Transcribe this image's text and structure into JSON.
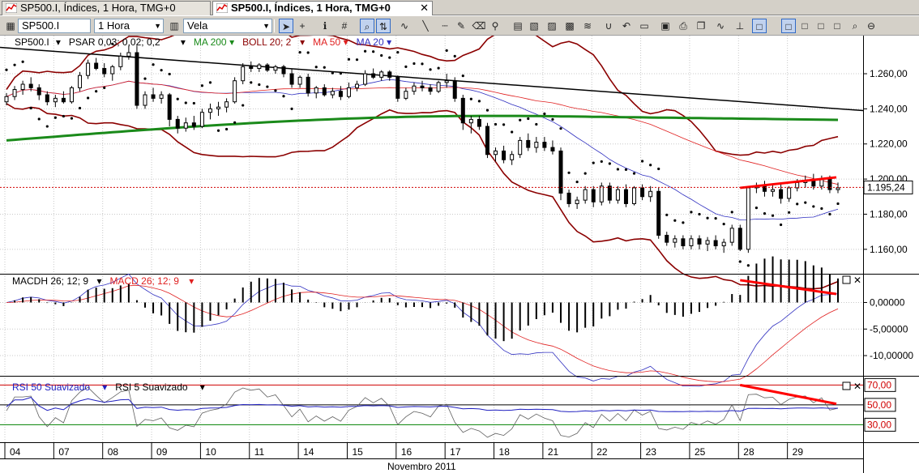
{
  "tabs": [
    {
      "label": "SP500.I, Índices, 1 Hora, TMG+0",
      "active": false
    },
    {
      "label": "SP500.I, Índices, 1 Hora, TMG+0",
      "active": true
    }
  ],
  "toolbar": {
    "symbol": "SP500.I",
    "timeframe": "1 Hora",
    "chart_style": "Vela",
    "icons": [
      "cursor-icon",
      "crosshair-icon",
      "info-icon",
      "grid-icon",
      "zoom-icon",
      "scale-icon",
      "wave-icon",
      "line-tool-icon",
      "dash-icon",
      "pencil-icon",
      "eraser-icon",
      "magnet-icon",
      "chart-a-icon",
      "chart-b-icon",
      "chart-c-icon",
      "chart-d-icon",
      "chart-e-icon",
      "magnet2-icon",
      "undo-icon",
      "open-icon",
      "save-icon",
      "print-icon",
      "copy-icon",
      "indicator-icon",
      "pin-icon",
      "layout-a-icon",
      "layout-b-icon",
      "layout-c-icon",
      "layout-d-icon",
      "layout-e-icon",
      "zoom-fit-icon",
      "zoom-out-icon"
    ]
  },
  "colors": {
    "candle": "#000000",
    "psar": "#000000",
    "ma200": "#1a8a1a",
    "boll": "#8b0000",
    "ma50": "#e02020",
    "ma20": "#3030c0",
    "trend": "#000000",
    "divergence": "#ff0000",
    "price_line": "#d00000",
    "rsi50": "#2020c0",
    "rsi5": "#606060",
    "rsi_overbought": "#d00000",
    "rsi_oversold": "#008000"
  },
  "price_panel": {
    "legend": [
      {
        "name": "SP500.I",
        "color": "#000000"
      },
      {
        "name": "PSAR 0,03; 0,02; 0,2",
        "color": "#000000"
      },
      {
        "name": "MA 200",
        "color": "#1a8a1a"
      },
      {
        "name": "BOLL 20; 2",
        "color": "#8b0000"
      },
      {
        "name": "MA 50",
        "color": "#e02020"
      },
      {
        "name": "MA 20",
        "color": "#3030c0"
      }
    ],
    "last_price": "1.195,24",
    "y_ticks": [
      "1.260,00",
      "1.240,00",
      "1.220,00",
      "1.200,00",
      "1.180,00",
      "1.160,00"
    ]
  },
  "macd_panel": {
    "legend": [
      {
        "name": "MACDH 26; 12; 9",
        "color": "#000000"
      },
      {
        "name": "MACD 26; 12; 9",
        "color": "#e02020"
      }
    ],
    "y_ticks": [
      "0,00000",
      "-5,00000",
      "-10,00000"
    ]
  },
  "rsi_panel": {
    "legend": [
      {
        "name": "RSI 50 Suavizado",
        "color": "#2020c0"
      },
      {
        "name": "RSI 5 Suavizado",
        "color": "#000000"
      }
    ],
    "y_ticks": [
      "70,00",
      "50,00",
      "30,00"
    ]
  },
  "x_axis": {
    "day_labels": [
      "04",
      "07",
      "08",
      "09",
      "10",
      "11",
      "14",
      "15",
      "16",
      "17",
      "18",
      "21",
      "22",
      "23",
      "25",
      "28",
      "29"
    ],
    "month_label": "Novembro 2011"
  },
  "chart_data": {
    "type": "candlestick",
    "symbol": "SP500.I",
    "timeframe": "1 Hora",
    "x_days": [
      "04",
      "07",
      "08",
      "09",
      "10",
      "11",
      "14",
      "15",
      "16",
      "17",
      "18",
      "21",
      "22",
      "23",
      "25",
      "28",
      "29"
    ],
    "price_ylim": [
      1147,
      1278
    ],
    "last_price": 1195.24,
    "candles": [
      {
        "o": 1244,
        "h": 1249,
        "l": 1242,
        "c": 1247
      },
      {
        "o": 1247,
        "h": 1253,
        "l": 1245,
        "c": 1251
      },
      {
        "o": 1251,
        "h": 1256,
        "l": 1248,
        "c": 1254
      },
      {
        "o": 1254,
        "h": 1258,
        "l": 1250,
        "c": 1252
      },
      {
        "o": 1252,
        "h": 1254,
        "l": 1245,
        "c": 1248
      },
      {
        "o": 1248,
        "h": 1250,
        "l": 1242,
        "c": 1244
      },
      {
        "o": 1244,
        "h": 1248,
        "l": 1241,
        "c": 1246
      },
      {
        "o": 1246,
        "h": 1250,
        "l": 1243,
        "c": 1244
      },
      {
        "o": 1244,
        "h": 1253,
        "l": 1243,
        "c": 1252
      },
      {
        "o": 1252,
        "h": 1261,
        "l": 1250,
        "c": 1259
      },
      {
        "o": 1259,
        "h": 1268,
        "l": 1257,
        "c": 1266
      },
      {
        "o": 1266,
        "h": 1269,
        "l": 1262,
        "c": 1263
      },
      {
        "o": 1263,
        "h": 1266,
        "l": 1258,
        "c": 1260
      },
      {
        "o": 1260,
        "h": 1265,
        "l": 1256,
        "c": 1264
      },
      {
        "o": 1264,
        "h": 1272,
        "l": 1262,
        "c": 1270
      },
      {
        "o": 1270,
        "h": 1276,
        "l": 1268,
        "c": 1272
      },
      {
        "o": 1272,
        "h": 1276,
        "l": 1240,
        "c": 1242
      },
      {
        "o": 1242,
        "h": 1250,
        "l": 1240,
        "c": 1248
      },
      {
        "o": 1248,
        "h": 1252,
        "l": 1244,
        "c": 1246
      },
      {
        "o": 1246,
        "h": 1250,
        "l": 1243,
        "c": 1248
      },
      {
        "o": 1248,
        "h": 1249,
        "l": 1230,
        "c": 1234
      },
      {
        "o": 1234,
        "h": 1236,
        "l": 1226,
        "c": 1229
      },
      {
        "o": 1229,
        "h": 1235,
        "l": 1227,
        "c": 1232
      },
      {
        "o": 1232,
        "h": 1236,
        "l": 1228,
        "c": 1230
      },
      {
        "o": 1230,
        "h": 1240,
        "l": 1229,
        "c": 1238
      },
      {
        "o": 1238,
        "h": 1243,
        "l": 1234,
        "c": 1240
      },
      {
        "o": 1240,
        "h": 1244,
        "l": 1236,
        "c": 1241
      },
      {
        "o": 1241,
        "h": 1246,
        "l": 1238,
        "c": 1244
      },
      {
        "o": 1244,
        "h": 1258,
        "l": 1243,
        "c": 1256
      },
      {
        "o": 1256,
        "h": 1266,
        "l": 1254,
        "c": 1264
      },
      {
        "o": 1264,
        "h": 1267,
        "l": 1261,
        "c": 1263
      },
      {
        "o": 1263,
        "h": 1266,
        "l": 1261,
        "c": 1265
      },
      {
        "o": 1265,
        "h": 1266,
        "l": 1261,
        "c": 1262
      },
      {
        "o": 1262,
        "h": 1265,
        "l": 1260,
        "c": 1264
      },
      {
        "o": 1264,
        "h": 1265,
        "l": 1258,
        "c": 1260
      },
      {
        "o": 1260,
        "h": 1263,
        "l": 1252,
        "c": 1254
      },
      {
        "o": 1254,
        "h": 1259,
        "l": 1252,
        "c": 1258
      },
      {
        "o": 1258,
        "h": 1260,
        "l": 1247,
        "c": 1249
      },
      {
        "o": 1249,
        "h": 1253,
        "l": 1246,
        "c": 1252
      },
      {
        "o": 1252,
        "h": 1254,
        "l": 1247,
        "c": 1248
      },
      {
        "o": 1248,
        "h": 1252,
        "l": 1246,
        "c": 1250
      },
      {
        "o": 1250,
        "h": 1253,
        "l": 1245,
        "c": 1247
      },
      {
        "o": 1247,
        "h": 1255,
        "l": 1246,
        "c": 1252
      },
      {
        "o": 1252,
        "h": 1256,
        "l": 1250,
        "c": 1254
      },
      {
        "o": 1254,
        "h": 1262,
        "l": 1253,
        "c": 1260
      },
      {
        "o": 1260,
        "h": 1263,
        "l": 1257,
        "c": 1258
      },
      {
        "o": 1258,
        "h": 1262,
        "l": 1256,
        "c": 1261
      },
      {
        "o": 1261,
        "h": 1262,
        "l": 1256,
        "c": 1258
      },
      {
        "o": 1258,
        "h": 1259,
        "l": 1244,
        "c": 1246
      },
      {
        "o": 1246,
        "h": 1252,
        "l": 1245,
        "c": 1250
      },
      {
        "o": 1250,
        "h": 1255,
        "l": 1248,
        "c": 1253
      },
      {
        "o": 1253,
        "h": 1256,
        "l": 1250,
        "c": 1252
      },
      {
        "o": 1252,
        "h": 1254,
        "l": 1248,
        "c": 1250
      },
      {
        "o": 1250,
        "h": 1256,
        "l": 1249,
        "c": 1255
      },
      {
        "o": 1255,
        "h": 1260,
        "l": 1252,
        "c": 1256
      },
      {
        "o": 1256,
        "h": 1258,
        "l": 1244,
        "c": 1246
      },
      {
        "o": 1246,
        "h": 1248,
        "l": 1228,
        "c": 1232
      },
      {
        "o": 1232,
        "h": 1236,
        "l": 1226,
        "c": 1234
      },
      {
        "o": 1234,
        "h": 1236,
        "l": 1228,
        "c": 1230
      },
      {
        "o": 1230,
        "h": 1232,
        "l": 1212,
        "c": 1214
      },
      {
        "o": 1214,
        "h": 1218,
        "l": 1210,
        "c": 1216
      },
      {
        "o": 1216,
        "h": 1219,
        "l": 1209,
        "c": 1211
      },
      {
        "o": 1211,
        "h": 1216,
        "l": 1208,
        "c": 1214
      },
      {
        "o": 1214,
        "h": 1224,
        "l": 1212,
        "c": 1222
      },
      {
        "o": 1222,
        "h": 1226,
        "l": 1216,
        "c": 1218
      },
      {
        "o": 1218,
        "h": 1224,
        "l": 1215,
        "c": 1221
      },
      {
        "o": 1221,
        "h": 1224,
        "l": 1216,
        "c": 1218
      },
      {
        "o": 1218,
        "h": 1222,
        "l": 1214,
        "c": 1216
      },
      {
        "o": 1216,
        "h": 1218,
        "l": 1188,
        "c": 1192
      },
      {
        "o": 1192,
        "h": 1194,
        "l": 1184,
        "c": 1186
      },
      {
        "o": 1186,
        "h": 1190,
        "l": 1183,
        "c": 1188
      },
      {
        "o": 1188,
        "h": 1196,
        "l": 1186,
        "c": 1194
      },
      {
        "o": 1194,
        "h": 1196,
        "l": 1184,
        "c": 1187
      },
      {
        "o": 1187,
        "h": 1198,
        "l": 1185,
        "c": 1196
      },
      {
        "o": 1196,
        "h": 1198,
        "l": 1186,
        "c": 1188
      },
      {
        "o": 1188,
        "h": 1196,
        "l": 1186,
        "c": 1194
      },
      {
        "o": 1194,
        "h": 1197,
        "l": 1184,
        "c": 1186
      },
      {
        "o": 1186,
        "h": 1196,
        "l": 1185,
        "c": 1195
      },
      {
        "o": 1195,
        "h": 1197,
        "l": 1188,
        "c": 1190
      },
      {
        "o": 1190,
        "h": 1196,
        "l": 1187,
        "c": 1193
      },
      {
        "o": 1193,
        "h": 1195,
        "l": 1166,
        "c": 1168
      },
      {
        "o": 1168,
        "h": 1170,
        "l": 1162,
        "c": 1164
      },
      {
        "o": 1164,
        "h": 1168,
        "l": 1161,
        "c": 1166
      },
      {
        "o": 1166,
        "h": 1168,
        "l": 1160,
        "c": 1162
      },
      {
        "o": 1162,
        "h": 1168,
        "l": 1160,
        "c": 1166
      },
      {
        "o": 1166,
        "h": 1168,
        "l": 1160,
        "c": 1163
      },
      {
        "o": 1163,
        "h": 1167,
        "l": 1159,
        "c": 1165
      },
      {
        "o": 1165,
        "h": 1168,
        "l": 1160,
        "c": 1162
      },
      {
        "o": 1162,
        "h": 1166,
        "l": 1158,
        "c": 1164
      },
      {
        "o": 1164,
        "h": 1174,
        "l": 1162,
        "c": 1172
      },
      {
        "o": 1172,
        "h": 1174,
        "l": 1159,
        "c": 1160
      },
      {
        "o": 1160,
        "h": 1196,
        "l": 1158,
        "c": 1195
      },
      {
        "o": 1195,
        "h": 1198,
        "l": 1192,
        "c": 1196
      },
      {
        "o": 1196,
        "h": 1199,
        "l": 1190,
        "c": 1193
      },
      {
        "o": 1193,
        "h": 1197,
        "l": 1190,
        "c": 1194
      },
      {
        "o": 1194,
        "h": 1198,
        "l": 1186,
        "c": 1189
      },
      {
        "o": 1189,
        "h": 1196,
        "l": 1187,
        "c": 1195
      },
      {
        "o": 1195,
        "h": 1200,
        "l": 1193,
        "c": 1198
      },
      {
        "o": 1198,
        "h": 1202,
        "l": 1195,
        "c": 1199
      },
      {
        "o": 1199,
        "h": 1203,
        "l": 1194,
        "c": 1196
      },
      {
        "o": 1196,
        "h": 1202,
        "l": 1194,
        "c": 1200
      },
      {
        "o": 1200,
        "h": 1202,
        "l": 1192,
        "c": 1194
      },
      {
        "o": 1194,
        "h": 1198,
        "l": 1192,
        "c": 1195
      }
    ],
    "macd_ylim": [
      -13.5,
      4.8
    ],
    "rsi_ylim": [
      14,
      76
    ],
    "rsi_levels": [
      70,
      50,
      30
    ]
  }
}
